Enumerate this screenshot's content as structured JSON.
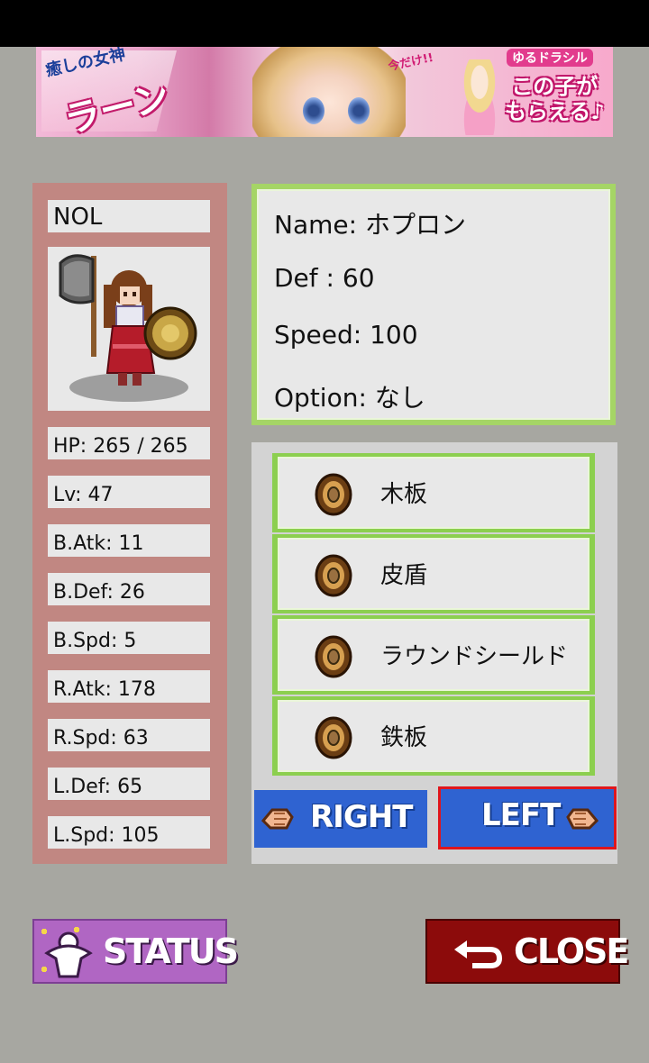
{
  "banner": {
    "tag_line": "癒しの女神",
    "title": "ラーン",
    "limited": "今だけ!!",
    "brand": "ゆるドラシル",
    "promo_line1": "この子が",
    "promo_line2": "もらえる♪"
  },
  "character": {
    "name": "NOL",
    "stats": [
      {
        "label": "HP: 265 / 265"
      },
      {
        "label": "Lv: 47"
      },
      {
        "label": "B.Atk: 11"
      },
      {
        "label": "B.Def: 26"
      },
      {
        "label": "B.Spd: 5"
      },
      {
        "label": "R.Atk: 178"
      },
      {
        "label": "R.Spd: 63"
      },
      {
        "label": "L.Def: 65"
      },
      {
        "label": "L.Spd: 105"
      }
    ]
  },
  "item_info": {
    "name": "Name: ホプロン",
    "def": "Def : 60",
    "speed": "Speed: 100",
    "option": "Option: なし"
  },
  "equipment_list": [
    {
      "name": "木板",
      "icon": "shield-icon"
    },
    {
      "name": "皮盾",
      "icon": "shield-icon"
    },
    {
      "name": "ラウンドシールド",
      "icon": "shield-icon"
    },
    {
      "name": "鉄板",
      "icon": "shield-icon"
    }
  ],
  "hand_buttons": {
    "right": "RIGHT",
    "left": "LEFT",
    "selected": "LEFT"
  },
  "footer": {
    "status": "STATUS",
    "close": "CLOSE"
  },
  "colors": {
    "background": "#a7a7a1",
    "stats_panel": "#c18782",
    "info_border": "#a5d566",
    "selected_outline": "#e0161c",
    "hand_button": "#2f63d1"
  }
}
